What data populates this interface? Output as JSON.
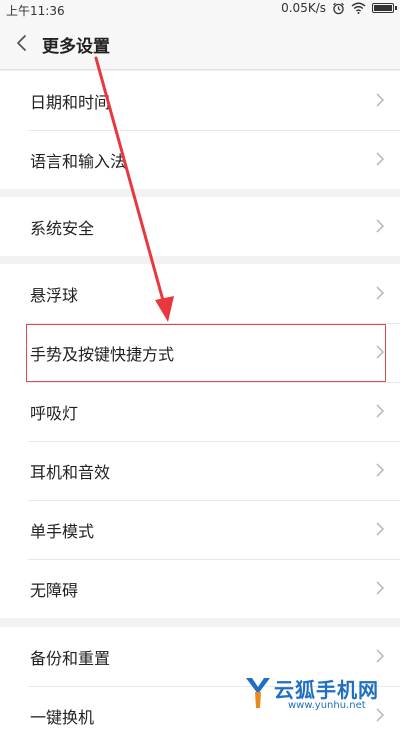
{
  "status_bar": {
    "time": "上午11:36",
    "network_speed": "0.05K/s",
    "battery_level": 0.9,
    "icons": [
      "alarm-icon",
      "wifi-icon",
      "battery-icon"
    ]
  },
  "header": {
    "title": "更多设置"
  },
  "groups": [
    {
      "items": [
        {
          "label": "日期和时间"
        },
        {
          "label": "语言和输入法"
        }
      ]
    },
    {
      "items": [
        {
          "label": "系统安全"
        }
      ]
    },
    {
      "items": [
        {
          "label": "悬浮球"
        },
        {
          "label": "手势及按键快捷方式"
        },
        {
          "label": "呼吸灯"
        },
        {
          "label": "耳机和音效"
        },
        {
          "label": "单手模式"
        },
        {
          "label": "无障碍"
        }
      ]
    },
    {
      "items": [
        {
          "label": "备份和重置"
        },
        {
          "label": "一键换机"
        }
      ]
    }
  ],
  "annotation": {
    "highlight_color": "#e04b4b",
    "arrow_color": "#e8383d"
  },
  "watermark": {
    "brand": "云狐手机网",
    "url": "www.yunhu.net"
  },
  "colors": {
    "background": "#f2f2f2",
    "surface": "#ffffff",
    "text": "#222222",
    "brand_blue": "#1f6fc2"
  }
}
